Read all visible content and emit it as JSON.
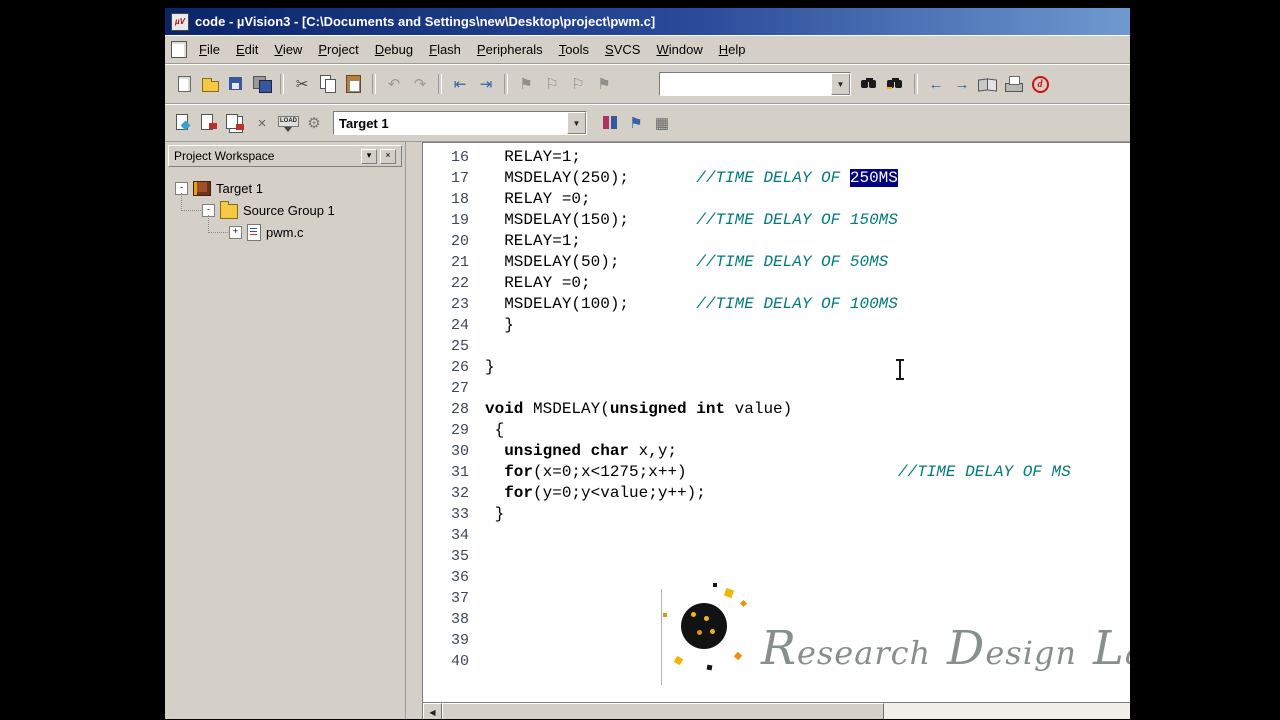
{
  "window": {
    "title": "code  - µVision3 - [C:\\Documents and Settings\\new\\Desktop\\project\\pwm.c]"
  },
  "menu": {
    "items": [
      "File",
      "Edit",
      "View",
      "Project",
      "Debug",
      "Flash",
      "Peripherals",
      "Tools",
      "SVCS",
      "Window",
      "Help"
    ]
  },
  "toolbar_main": {
    "find_value": "",
    "icons_left": [
      {
        "name": "new-file"
      },
      {
        "name": "open-folder"
      },
      {
        "name": "save"
      },
      {
        "name": "save-all"
      },
      {
        "sep": 1
      },
      {
        "name": "cut",
        "glyph": "✂",
        "color": "#444444"
      },
      {
        "name": "copy"
      },
      {
        "name": "paste"
      },
      {
        "sep": 1
      },
      {
        "name": "undo",
        "glyph": "↶",
        "color": "#9a9a96"
      },
      {
        "name": "redo",
        "glyph": "↷",
        "color": "#9a9a96"
      },
      {
        "sep": 1
      },
      {
        "name": "unindent",
        "glyph": "⇤",
        "color": "#3a62a8"
      },
      {
        "name": "indent",
        "glyph": "⇥",
        "color": "#3a62a8"
      },
      {
        "sep": 1
      },
      {
        "name": "bookmark-toggle",
        "glyph": "⚑",
        "color": "#8f8f8b"
      },
      {
        "name": "bookmark-prev",
        "glyph": "⚐",
        "color": "#8f8f8b"
      },
      {
        "name": "bookmark-next",
        "glyph": "⚐",
        "color": "#8f8f8b"
      },
      {
        "name": "bookmark-clear",
        "glyph": "⚑",
        "color": "#8f8f8b"
      }
    ],
    "icons_right": [
      {
        "name": "find-in-files"
      },
      {
        "name": "find"
      },
      {
        "sep": 1
      },
      {
        "name": "navigate-back",
        "glyph": "←",
        "color": "#3a62a8"
      },
      {
        "name": "navigate-forward",
        "glyph": "→",
        "color": "#3a62a8"
      },
      {
        "name": "books"
      },
      {
        "name": "print"
      },
      {
        "name": "update"
      }
    ]
  },
  "toolbar_build": {
    "target_value": "Target 1",
    "icons_left": [
      {
        "name": "translate-file"
      },
      {
        "name": "build-target"
      },
      {
        "name": "rebuild-all"
      },
      {
        "name": "stop-build",
        "glyph": "×",
        "color": "#666660"
      },
      {
        "name": "download-flash"
      },
      {
        "name": "configure-flash",
        "glyph": "⚙",
        "color": "#78786f"
      }
    ],
    "icons_right": [
      {
        "name": "options-for-target"
      },
      {
        "name": "file-extensions",
        "glyph": "⚑",
        "color": "#3a62a8"
      },
      {
        "name": "environment",
        "glyph": "▦",
        "color": "#666666"
      }
    ]
  },
  "workspace": {
    "title": "Project Workspace",
    "tree": [
      {
        "label": "Target 1",
        "icon": "target",
        "expander": "minus",
        "indent": 0
      },
      {
        "label": "Source Group 1",
        "icon": "folder",
        "expander": "minus",
        "indent": 1
      },
      {
        "label": "pwm.c",
        "icon": "cfile",
        "expander": "plus",
        "indent": 2
      }
    ]
  },
  "editor": {
    "lines": [
      {
        "no": 16,
        "segs": [
          {
            "c": "p",
            "t": "  RELAY=1;"
          }
        ]
      },
      {
        "no": 17,
        "segs": [
          {
            "c": "p",
            "t": "  MSDELAY(250);       "
          },
          {
            "c": "m",
            "t": "//TIME DELAY OF "
          },
          {
            "c": "s",
            "t": "250MS"
          }
        ]
      },
      {
        "no": 18,
        "segs": [
          {
            "c": "p",
            "t": "  RELAY =0;"
          }
        ]
      },
      {
        "no": 19,
        "segs": [
          {
            "c": "p",
            "t": "  MSDELAY(150);       "
          },
          {
            "c": "m",
            "t": "//TIME DELAY OF 150MS"
          }
        ]
      },
      {
        "no": 20,
        "segs": [
          {
            "c": "p",
            "t": "  RELAY=1;"
          }
        ]
      },
      {
        "no": 21,
        "segs": [
          {
            "c": "p",
            "t": "  MSDELAY(50);        "
          },
          {
            "c": "m",
            "t": "//TIME DELAY OF 50MS"
          }
        ]
      },
      {
        "no": 22,
        "segs": [
          {
            "c": "p",
            "t": "  RELAY =0;"
          }
        ]
      },
      {
        "no": 23,
        "segs": [
          {
            "c": "p",
            "t": "  MSDELAY(100);       "
          },
          {
            "c": "m",
            "t": "//TIME DELAY OF 100MS"
          }
        ]
      },
      {
        "no": 24,
        "segs": [
          {
            "c": "p",
            "t": "  }"
          }
        ]
      },
      {
        "no": 25,
        "segs": []
      },
      {
        "no": 26,
        "segs": [
          {
            "c": "p",
            "t": "}"
          }
        ]
      },
      {
        "no": 27,
        "segs": []
      },
      {
        "no": 28,
        "segs": [
          {
            "c": "k",
            "t": "void"
          },
          {
            "c": "p",
            "t": " MSDELAY("
          },
          {
            "c": "k",
            "t": "unsigned int"
          },
          {
            "c": "p",
            "t": " value)"
          }
        ]
      },
      {
        "no": 29,
        "segs": [
          {
            "c": "p",
            "t": " {"
          }
        ]
      },
      {
        "no": 30,
        "segs": [
          {
            "c": "p",
            "t": "  "
          },
          {
            "c": "k",
            "t": "unsigned char"
          },
          {
            "c": "p",
            "t": " x,y;"
          }
        ]
      },
      {
        "no": 31,
        "segs": [
          {
            "c": "p",
            "t": "  "
          },
          {
            "c": "k",
            "t": "for"
          },
          {
            "c": "p",
            "t": "(x=0;x<1275;x++)                      "
          },
          {
            "c": "m",
            "t": "//TIME DELAY OF MS"
          }
        ]
      },
      {
        "no": 32,
        "segs": [
          {
            "c": "p",
            "t": "  "
          },
          {
            "c": "k",
            "t": "for"
          },
          {
            "c": "p",
            "t": "(y=0;y<value;y++);"
          }
        ]
      },
      {
        "no": 33,
        "segs": [
          {
            "c": "p",
            "t": " }"
          }
        ]
      },
      {
        "no": 34,
        "segs": []
      },
      {
        "no": 35,
        "segs": []
      },
      {
        "no": 36,
        "segs": []
      },
      {
        "no": 37,
        "segs": []
      },
      {
        "no": 38,
        "segs": []
      },
      {
        "no": 39,
        "segs": []
      },
      {
        "no": 40,
        "segs": []
      }
    ]
  },
  "watermark": {
    "words": [
      "Research",
      "Design",
      "Lab"
    ]
  },
  "colors": {
    "titlebar": "#0a246a",
    "chrome": "#d4d0c8",
    "comment": "#007a7a",
    "selection_bg": "#000080",
    "selection_fg": "#ffffff"
  }
}
